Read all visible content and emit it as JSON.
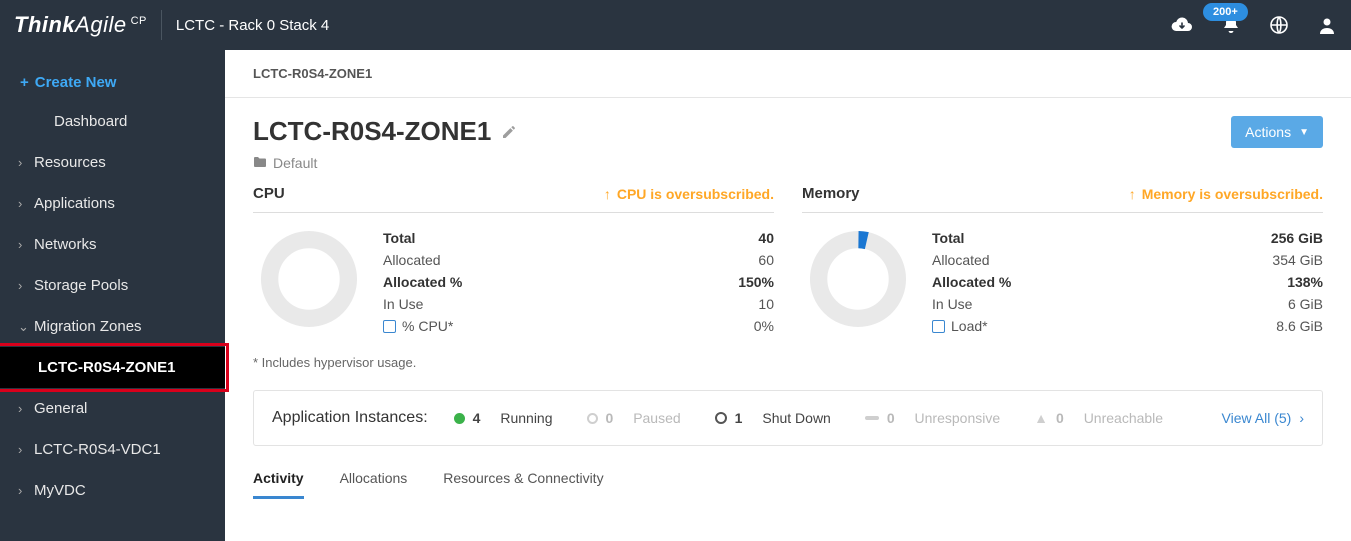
{
  "header": {
    "brand_think": "Think",
    "brand_agile": "Agile",
    "brand_cp": "CP",
    "title": "LCTC - Rack 0 Stack 4",
    "bell_badge": "200+"
  },
  "sidebar": {
    "create_label": "Create New",
    "items": [
      {
        "label": "Dashboard",
        "chev": ""
      },
      {
        "label": "Resources",
        "chev": "›"
      },
      {
        "label": "Applications",
        "chev": "›"
      },
      {
        "label": "Networks",
        "chev": "›"
      },
      {
        "label": "Storage Pools",
        "chev": "›"
      },
      {
        "label": "Migration Zones",
        "chev": "⌄"
      },
      {
        "label": "LCTC-R0S4-ZONE1",
        "chev": ""
      },
      {
        "label": "General",
        "chev": "›"
      },
      {
        "label": "LCTC-R0S4-VDC1",
        "chev": "›"
      },
      {
        "label": "MyVDC",
        "chev": "›"
      }
    ]
  },
  "breadcrumb": "LCTC-R0S4-ZONE1",
  "page": {
    "title": "LCTC-R0S4-ZONE1",
    "folder": "Default",
    "actions": "Actions"
  },
  "cpu": {
    "title": "CPU",
    "warn": "CPU is oversubscribed.",
    "total_lbl": "Total",
    "total_val": "40",
    "alloc_lbl": "Allocated",
    "alloc_val": "60",
    "allocpct_lbl": "Allocated %",
    "allocpct_val": "150%",
    "inuse_lbl": "In Use",
    "inuse_val": "10",
    "pct_lbl": "% CPU*",
    "pct_val": "0%"
  },
  "mem": {
    "title": "Memory",
    "warn": "Memory is oversubscribed.",
    "total_lbl": "Total",
    "total_val": "256 GiB",
    "alloc_lbl": "Allocated",
    "alloc_val": "354 GiB",
    "allocpct_lbl": "Allocated %",
    "allocpct_val": "138%",
    "inuse_lbl": "In Use",
    "inuse_val": "6 GiB",
    "load_lbl": "Load*",
    "load_val": "8.6 GiB"
  },
  "footnote": "* Includes hypervisor usage.",
  "instances": {
    "lead": "Application Instances:",
    "running_n": "4",
    "running_lbl": "Running",
    "paused_n": "0",
    "paused_lbl": "Paused",
    "shutdown_n": "1",
    "shutdown_lbl": "Shut Down",
    "unresp_n": "0",
    "unresp_lbl": "Unresponsive",
    "unreach_n": "0",
    "unreach_lbl": "Unreachable",
    "viewall": "View All (5)"
  },
  "tabs": {
    "activity": "Activity",
    "allocations": "Allocations",
    "resconn": "Resources & Connectivity"
  }
}
